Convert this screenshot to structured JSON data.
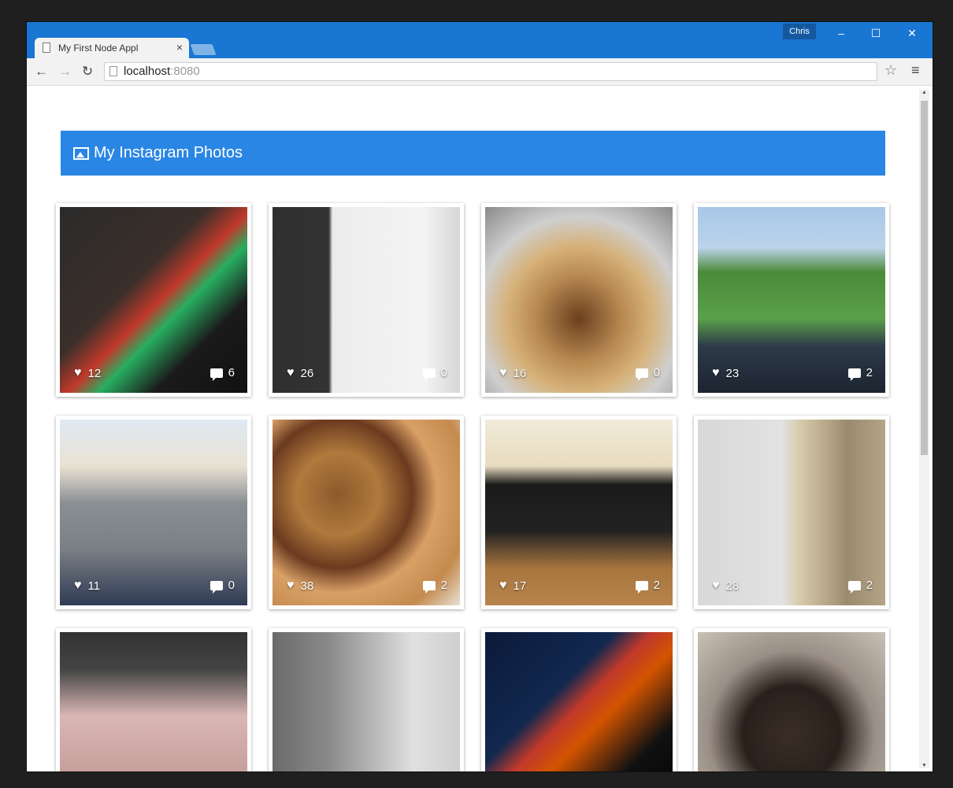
{
  "browser": {
    "tab_title": "My First Node Appl",
    "tab_close": "×",
    "user": "Chris",
    "url_host": "localhost",
    "url_port": ":8080",
    "window_controls": {
      "minimize": "–",
      "maximize": "☐",
      "close": "✕"
    }
  },
  "page": {
    "title": "My Instagram Photos"
  },
  "photos": [
    {
      "likes": "12",
      "comments": "6",
      "bg": "linear-gradient(135deg,#2b2b2b 0%,#3a2f2a 40%,#c0392b 52%,#27ae60 60%,#1a1a1a 75%,#111 100%)"
    },
    {
      "likes": "26",
      "comments": "0",
      "bg": "linear-gradient(90deg,#2f2f2f 0%,#333 30%,#ececec 32%,#f4f4f4 80%,#d7d7d7 100%)"
    },
    {
      "likes": "16",
      "comments": "0",
      "bg": "radial-gradient(circle at 50% 60%,#6b3f1e 0%,#b98a52 30%,#d6b27a 50%,#cfcfcf 70%,#8a8a8a 100%)"
    },
    {
      "likes": "23",
      "comments": "2",
      "bg": "linear-gradient(180deg,#a8c8e8 0%,#bcd3ea 22%,#4a8a3a 35%,#5aa04a 60%,#2e3a4a 75%,#1c2430 100%)"
    },
    {
      "likes": "11",
      "comments": "0",
      "bg": "linear-gradient(180deg,#dfe9f3 0%,#e9e2d3 25%,#8a8f93 45%,#7a7f84 70%,#2f3b55 100%)"
    },
    {
      "likes": "38",
      "comments": "2",
      "bg": "radial-gradient(circle at 35% 40%,#8b5a2b 0%,#b07a3d 25%,#6b3a1f 45%,#d9a066 60%,#c48a4e 80%,#e9e1d6 100%)"
    },
    {
      "likes": "17",
      "comments": "2",
      "bg": "linear-gradient(180deg,#f1ead8 0%,#e8dcc0 25%,#1a1a1a 35%,#222 60%,#a8753f 80%,#b7844c 100%)"
    },
    {
      "likes": "28",
      "comments": "2",
      "bg": "linear-gradient(90deg,#d8d8d8 0%,#e2e2e2 45%,#d6c9a8 55%,#9b8b6e 80%,#b5a486 100%)"
    },
    {
      "likes": "",
      "comments": "",
      "bg": "linear-gradient(180deg,#333 0%,#444 20%,#d9b6b4 45%,#caa3a0 70%,#b48d89 100%)"
    },
    {
      "likes": "",
      "comments": "",
      "bg": "linear-gradient(90deg,#6a6a6a 0%,#8a8a8a 30%,#b9b9b9 55%,#e0e0e0 75%,#cfcfcf 100%)"
    },
    {
      "likes": "",
      "comments": "",
      "bg": "linear-gradient(135deg,#0b1a3a 0%,#12284f 35%,#c0392b 45%,#d35400 55%,#111 75%,#000 100%)"
    },
    {
      "likes": "",
      "comments": "",
      "bg": "radial-gradient(circle at 50% 55%,#3a2d27 0%,#2a201b 35%,#9a8f86 60%,#c9c0b6 100%)"
    }
  ]
}
